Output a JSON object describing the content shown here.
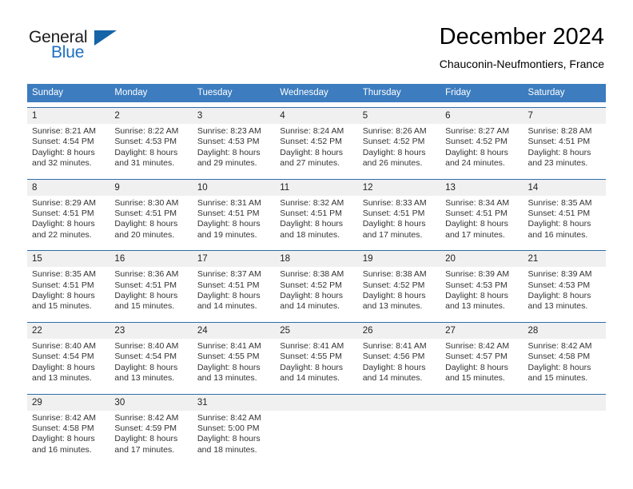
{
  "logo": {
    "word_one": "General",
    "word_two": "Blue",
    "mark": "blue-triangle"
  },
  "header": {
    "title": "December 2024",
    "location": "Chauconin-Neufmontiers, France"
  },
  "colors": {
    "header_blue": "#3c7cbf",
    "week_rule": "#2e6da8",
    "number_band": "#f0f0f0",
    "logo_blue": "#1c6fc0",
    "text": "#333333"
  },
  "calendar": {
    "weekdays": [
      "Sunday",
      "Monday",
      "Tuesday",
      "Wednesday",
      "Thursday",
      "Friday",
      "Saturday"
    ],
    "weeks": [
      [
        {
          "date": "1",
          "sunrise": "Sunrise: 8:21 AM",
          "sunset": "Sunset: 4:54 PM",
          "daylight1": "Daylight: 8 hours",
          "daylight2": "and 32 minutes."
        },
        {
          "date": "2",
          "sunrise": "Sunrise: 8:22 AM",
          "sunset": "Sunset: 4:53 PM",
          "daylight1": "Daylight: 8 hours",
          "daylight2": "and 31 minutes."
        },
        {
          "date": "3",
          "sunrise": "Sunrise: 8:23 AM",
          "sunset": "Sunset: 4:53 PM",
          "daylight1": "Daylight: 8 hours",
          "daylight2": "and 29 minutes."
        },
        {
          "date": "4",
          "sunrise": "Sunrise: 8:24 AM",
          "sunset": "Sunset: 4:52 PM",
          "daylight1": "Daylight: 8 hours",
          "daylight2": "and 27 minutes."
        },
        {
          "date": "5",
          "sunrise": "Sunrise: 8:26 AM",
          "sunset": "Sunset: 4:52 PM",
          "daylight1": "Daylight: 8 hours",
          "daylight2": "and 26 minutes."
        },
        {
          "date": "6",
          "sunrise": "Sunrise: 8:27 AM",
          "sunset": "Sunset: 4:52 PM",
          "daylight1": "Daylight: 8 hours",
          "daylight2": "and 24 minutes."
        },
        {
          "date": "7",
          "sunrise": "Sunrise: 8:28 AM",
          "sunset": "Sunset: 4:51 PM",
          "daylight1": "Daylight: 8 hours",
          "daylight2": "and 23 minutes."
        }
      ],
      [
        {
          "date": "8",
          "sunrise": "Sunrise: 8:29 AM",
          "sunset": "Sunset: 4:51 PM",
          "daylight1": "Daylight: 8 hours",
          "daylight2": "and 22 minutes."
        },
        {
          "date": "9",
          "sunrise": "Sunrise: 8:30 AM",
          "sunset": "Sunset: 4:51 PM",
          "daylight1": "Daylight: 8 hours",
          "daylight2": "and 20 minutes."
        },
        {
          "date": "10",
          "sunrise": "Sunrise: 8:31 AM",
          "sunset": "Sunset: 4:51 PM",
          "daylight1": "Daylight: 8 hours",
          "daylight2": "and 19 minutes."
        },
        {
          "date": "11",
          "sunrise": "Sunrise: 8:32 AM",
          "sunset": "Sunset: 4:51 PM",
          "daylight1": "Daylight: 8 hours",
          "daylight2": "and 18 minutes."
        },
        {
          "date": "12",
          "sunrise": "Sunrise: 8:33 AM",
          "sunset": "Sunset: 4:51 PM",
          "daylight1": "Daylight: 8 hours",
          "daylight2": "and 17 minutes."
        },
        {
          "date": "13",
          "sunrise": "Sunrise: 8:34 AM",
          "sunset": "Sunset: 4:51 PM",
          "daylight1": "Daylight: 8 hours",
          "daylight2": "and 17 minutes."
        },
        {
          "date": "14",
          "sunrise": "Sunrise: 8:35 AM",
          "sunset": "Sunset: 4:51 PM",
          "daylight1": "Daylight: 8 hours",
          "daylight2": "and 16 minutes."
        }
      ],
      [
        {
          "date": "15",
          "sunrise": "Sunrise: 8:35 AM",
          "sunset": "Sunset: 4:51 PM",
          "daylight1": "Daylight: 8 hours",
          "daylight2": "and 15 minutes."
        },
        {
          "date": "16",
          "sunrise": "Sunrise: 8:36 AM",
          "sunset": "Sunset: 4:51 PM",
          "daylight1": "Daylight: 8 hours",
          "daylight2": "and 15 minutes."
        },
        {
          "date": "17",
          "sunrise": "Sunrise: 8:37 AM",
          "sunset": "Sunset: 4:51 PM",
          "daylight1": "Daylight: 8 hours",
          "daylight2": "and 14 minutes."
        },
        {
          "date": "18",
          "sunrise": "Sunrise: 8:38 AM",
          "sunset": "Sunset: 4:52 PM",
          "daylight1": "Daylight: 8 hours",
          "daylight2": "and 14 minutes."
        },
        {
          "date": "19",
          "sunrise": "Sunrise: 8:38 AM",
          "sunset": "Sunset: 4:52 PM",
          "daylight1": "Daylight: 8 hours",
          "daylight2": "and 13 minutes."
        },
        {
          "date": "20",
          "sunrise": "Sunrise: 8:39 AM",
          "sunset": "Sunset: 4:53 PM",
          "daylight1": "Daylight: 8 hours",
          "daylight2": "and 13 minutes."
        },
        {
          "date": "21",
          "sunrise": "Sunrise: 8:39 AM",
          "sunset": "Sunset: 4:53 PM",
          "daylight1": "Daylight: 8 hours",
          "daylight2": "and 13 minutes."
        }
      ],
      [
        {
          "date": "22",
          "sunrise": "Sunrise: 8:40 AM",
          "sunset": "Sunset: 4:54 PM",
          "daylight1": "Daylight: 8 hours",
          "daylight2": "and 13 minutes."
        },
        {
          "date": "23",
          "sunrise": "Sunrise: 8:40 AM",
          "sunset": "Sunset: 4:54 PM",
          "daylight1": "Daylight: 8 hours",
          "daylight2": "and 13 minutes."
        },
        {
          "date": "24",
          "sunrise": "Sunrise: 8:41 AM",
          "sunset": "Sunset: 4:55 PM",
          "daylight1": "Daylight: 8 hours",
          "daylight2": "and 13 minutes."
        },
        {
          "date": "25",
          "sunrise": "Sunrise: 8:41 AM",
          "sunset": "Sunset: 4:55 PM",
          "daylight1": "Daylight: 8 hours",
          "daylight2": "and 14 minutes."
        },
        {
          "date": "26",
          "sunrise": "Sunrise: 8:41 AM",
          "sunset": "Sunset: 4:56 PM",
          "daylight1": "Daylight: 8 hours",
          "daylight2": "and 14 minutes."
        },
        {
          "date": "27",
          "sunrise": "Sunrise: 8:42 AM",
          "sunset": "Sunset: 4:57 PM",
          "daylight1": "Daylight: 8 hours",
          "daylight2": "and 15 minutes."
        },
        {
          "date": "28",
          "sunrise": "Sunrise: 8:42 AM",
          "sunset": "Sunset: 4:58 PM",
          "daylight1": "Daylight: 8 hours",
          "daylight2": "and 15 minutes."
        }
      ],
      [
        {
          "date": "29",
          "sunrise": "Sunrise: 8:42 AM",
          "sunset": "Sunset: 4:58 PM",
          "daylight1": "Daylight: 8 hours",
          "daylight2": "and 16 minutes."
        },
        {
          "date": "30",
          "sunrise": "Sunrise: 8:42 AM",
          "sunset": "Sunset: 4:59 PM",
          "daylight1": "Daylight: 8 hours",
          "daylight2": "and 17 minutes."
        },
        {
          "date": "31",
          "sunrise": "Sunrise: 8:42 AM",
          "sunset": "Sunset: 5:00 PM",
          "daylight1": "Daylight: 8 hours",
          "daylight2": "and 18 minutes."
        },
        {
          "date": "",
          "sunrise": "",
          "sunset": "",
          "daylight1": "",
          "daylight2": ""
        },
        {
          "date": "",
          "sunrise": "",
          "sunset": "",
          "daylight1": "",
          "daylight2": ""
        },
        {
          "date": "",
          "sunrise": "",
          "sunset": "",
          "daylight1": "",
          "daylight2": ""
        },
        {
          "date": "",
          "sunrise": "",
          "sunset": "",
          "daylight1": "",
          "daylight2": ""
        }
      ]
    ]
  }
}
